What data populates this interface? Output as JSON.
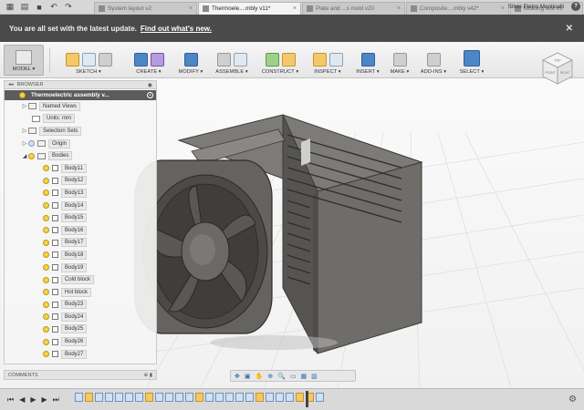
{
  "tabs": [
    {
      "label": "System layout v2",
      "active": false
    },
    {
      "label": "Thermoele....mbly v11*",
      "active": true
    },
    {
      "label": "Plate and ...s mold v20",
      "active": false
    },
    {
      "label": "Composite....mbly v42*",
      "active": false
    },
    {
      "label": "Molding test v9",
      "active": false
    }
  ],
  "user": {
    "name": "Silvio Pietro Monticelli",
    "help": "?"
  },
  "notification": {
    "text": "You are all set with the latest update.",
    "link": "Find out what's new."
  },
  "toolbar": {
    "model": "MODEL ▾",
    "groups": [
      {
        "label": "SKETCH ▾"
      },
      {
        "label": "CREATE ▾"
      },
      {
        "label": "MODIFY ▾"
      },
      {
        "label": "ASSEMBLE ▾"
      },
      {
        "label": "CONSTRUCT ▾"
      },
      {
        "label": "INSPECT ▾"
      },
      {
        "label": "INSERT ▾"
      },
      {
        "label": "MAKE ▾"
      },
      {
        "label": "ADD-INS ▾"
      },
      {
        "label": "SELECT ▾"
      }
    ]
  },
  "viewcube": {
    "faces": [
      "TOP",
      "FRONT",
      "RIGHT"
    ]
  },
  "browser": {
    "title": "BROWSER",
    "root": "Thermoelectric assembly v...",
    "nodes": [
      {
        "label": "Named Views",
        "type": "folder"
      },
      {
        "label": "Units: mm",
        "type": "units"
      },
      {
        "label": "Selection Sets",
        "type": "folder"
      },
      {
        "label": "Origin",
        "type": "folder"
      },
      {
        "label": "Bodies",
        "type": "folder"
      }
    ],
    "bodies": [
      "Body11",
      "Body12",
      "Body13",
      "Body14",
      "Body15",
      "Body16",
      "Body17",
      "Body18",
      "Body19",
      "Cold block",
      "Hot block",
      "Body23",
      "Body24",
      "Body25",
      "Body26",
      "Body27"
    ]
  },
  "comments": {
    "label": "COMMENTS"
  },
  "timeline": {
    "item_count": 25
  }
}
